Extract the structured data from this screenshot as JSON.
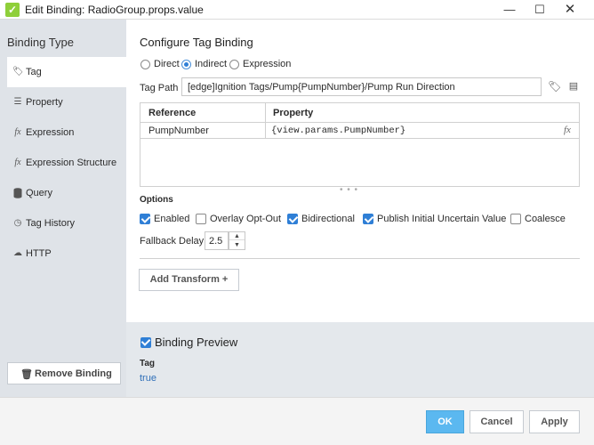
{
  "window": {
    "title": "Edit Binding: RadioGroup.props.value"
  },
  "sidebar": {
    "heading": "Binding Type",
    "items": [
      {
        "label": "Tag",
        "icon": "tag-icon"
      },
      {
        "label": "Property",
        "icon": "list-icon"
      },
      {
        "label": "Expression",
        "icon": "fx-icon"
      },
      {
        "label": "Expression Structure",
        "icon": "fx-icon"
      },
      {
        "label": "Query",
        "icon": "database-icon"
      },
      {
        "label": "Tag History",
        "icon": "clock-icon"
      },
      {
        "label": "HTTP",
        "icon": "cloud-icon"
      }
    ],
    "remove_label": "Remove Binding"
  },
  "config": {
    "title": "Configure Tag Binding",
    "modes": [
      "Direct",
      "Indirect",
      "Expression"
    ],
    "selected_mode": "Indirect",
    "tag_path_label": "Tag Path",
    "tag_path_value": "[edge]Ignition Tags/Pump{PumpNumber}/Pump Run Direction",
    "table": {
      "headers": [
        "Reference",
        "Property"
      ],
      "rows": [
        {
          "reference": "PumpNumber",
          "property": "{view.params.PumpNumber}"
        }
      ]
    },
    "options_label": "Options",
    "options": [
      {
        "label": "Enabled",
        "checked": true
      },
      {
        "label": "Overlay Opt-Out",
        "checked": false
      },
      {
        "label": "Bidirectional",
        "checked": true
      },
      {
        "label": "Publish Initial Uncertain Value",
        "checked": true
      },
      {
        "label": "Coalesce",
        "checked": false
      }
    ],
    "fallback_label": "Fallback Delay",
    "fallback_value": "2.5",
    "add_transform_label": "Add Transform +"
  },
  "preview": {
    "title": "Binding Preview",
    "enabled": true,
    "label": "Tag",
    "value": "true"
  },
  "footer": {
    "ok": "OK",
    "cancel": "Cancel",
    "apply": "Apply"
  },
  "colors": {
    "accent": "#2f7fd6",
    "ok_button": "#5bb8f0",
    "sidebar_bg": "#dfe3e8"
  }
}
